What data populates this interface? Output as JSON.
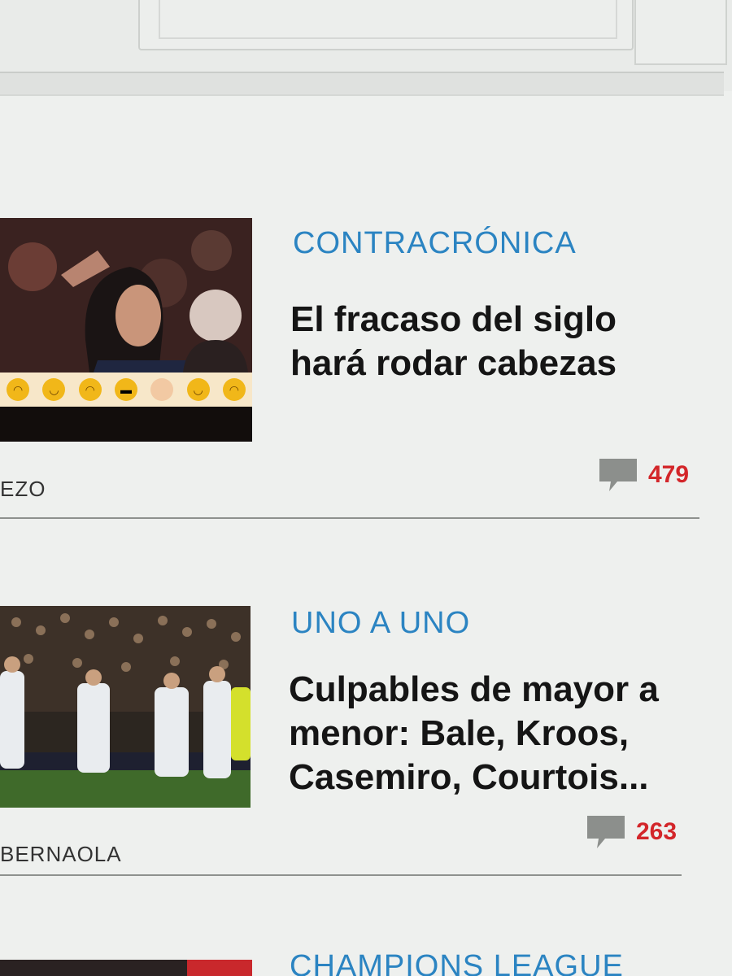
{
  "articles": [
    {
      "kicker": "CONTRACRÓNICA",
      "headline": "El fracaso del siglo hará rodar cabezas",
      "author": "EZO",
      "comment_count": "479",
      "thumbnail_icon": "photo-coach-emoji-icon"
    },
    {
      "kicker": "UNO A UNO",
      "headline": "Culpables de mayor a menor: Bale, Kroos, Casemiro, Courtois...",
      "author": "BERNAOLA",
      "comment_count": "263",
      "thumbnail_icon": "photo-players-icon"
    },
    {
      "kicker": "CHAMPIONS LEAGUE"
    }
  ],
  "colors": {
    "kicker": "#2b84c2",
    "comment_count": "#d3262a",
    "headline": "#151515"
  }
}
